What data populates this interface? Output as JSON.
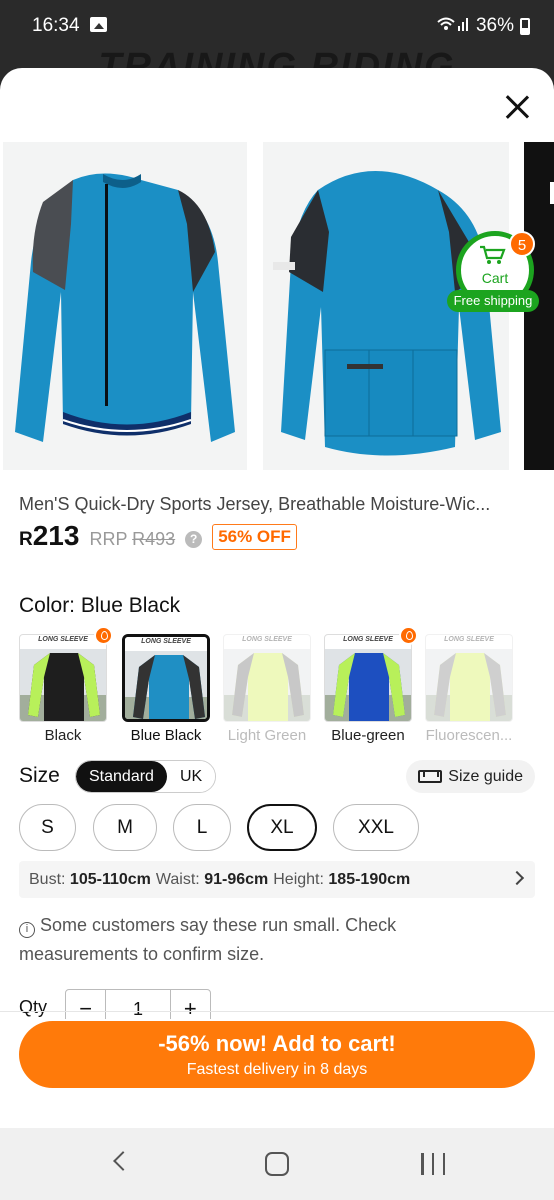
{
  "status_bar": {
    "time": "16:34",
    "battery": "36%"
  },
  "background_banner": "TRAINING RIDING",
  "product": {
    "title": "Men'S Quick-Dry Sports Jersey, Breathable Moisture-Wic...",
    "price_currency": "R",
    "price_amount": "213",
    "rrp_label": "RRP",
    "rrp_value": "R493",
    "discount_badge": "56% OFF"
  },
  "cart_badge": {
    "label": "Cart",
    "count": "5",
    "free_shipping": "Free shipping"
  },
  "colors": {
    "label": "Color: Blue Black",
    "options": [
      {
        "name": "Black",
        "hot": true,
        "selected": false,
        "disabled": false,
        "jersey": "#1e1e1e",
        "accent": "#b8f05a",
        "banner": "LONG SLEEVE"
      },
      {
        "name": "Blue Black",
        "hot": false,
        "selected": true,
        "disabled": false,
        "jersey": "#1f8fc4",
        "accent": "#333333",
        "banner": "LONG SLEEVE"
      },
      {
        "name": "Light Green",
        "hot": false,
        "selected": false,
        "disabled": true,
        "jersey": "#d6f25a",
        "accent": "#777777",
        "banner": "LONG SLEEVE"
      },
      {
        "name": "Blue-green",
        "hot": true,
        "selected": false,
        "disabled": false,
        "jersey": "#1d4fc0",
        "accent": "#b8f05a",
        "banner": "LONG SLEEVE"
      },
      {
        "name": "Fluorescen...",
        "hot": false,
        "selected": false,
        "disabled": true,
        "jersey": "#d6f25a",
        "accent": "#888888",
        "banner": "LONG SLEEVE"
      }
    ]
  },
  "size": {
    "label": "Size",
    "toggle": [
      "Standard",
      "UK"
    ],
    "toggle_active": "Standard",
    "guide_label": "Size guide",
    "options": [
      "S",
      "M",
      "L",
      "XL",
      "XXL"
    ],
    "selected": "XL"
  },
  "measurements": {
    "bust_label": "Bust:",
    "bust_value": "105-110cm",
    "waist_label": "Waist:",
    "waist_value": "91-96cm",
    "height_label": "Height:",
    "height_value": "185-190cm"
  },
  "fit_note": "Some customers say these run small. Check measurements to confirm size.",
  "quantity": {
    "label": "Qty",
    "value": "1",
    "minus": "−",
    "plus": "+"
  },
  "cta": {
    "line1": "-56% now! Add to cart!",
    "line2": "Fastest delivery in 8 days"
  },
  "colors_theme": {
    "accent": "#ff7a0a",
    "green": "#1ca41f",
    "jersey_blue": "#1f8fc4"
  }
}
